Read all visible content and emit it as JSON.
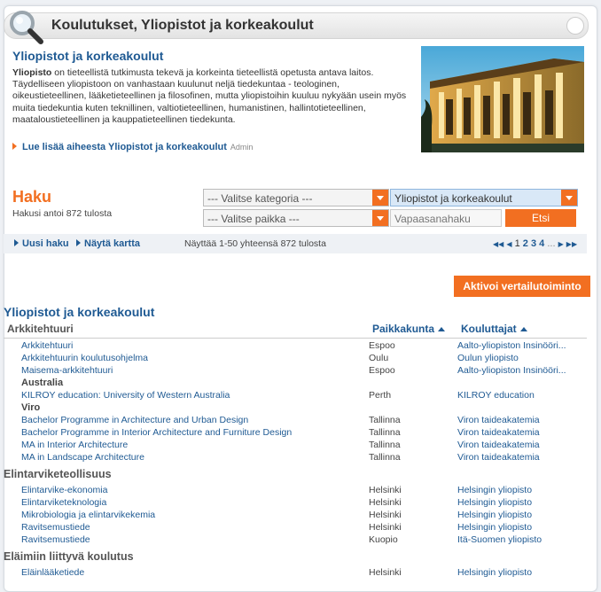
{
  "header": {
    "title": "Koulutukset, Yliopistot ja korkeakoulut"
  },
  "intro": {
    "title": "Yliopistot ja korkeakoulut",
    "lead": "Yliopisto",
    "text": " on tieteellistä tutkimusta tekevä ja korkeinta tieteellistä opetusta antava laitos. Täydelliseen yliopistoon on vanhastaan kuulunut neljä tiedekuntaa - teologinen, oikeustieteellinen, lääketieteellinen ja filosofinen, mutta yliopistoihin kuuluu nykyään usein myös muita tiedekuntia kuten teknillinen, valtiotieteellinen, humanistinen, hallintotieteellinen, maataloustieteellinen ja kauppatieteellinen tiedekunta.",
    "read_more": "Lue lisää aiheesta Yliopistot ja korkeakoulut",
    "admin": "Admin"
  },
  "search": {
    "title": "Haku",
    "result_count": "Hakusi antoi 872 tulosta",
    "category_placeholder": "--- Valitse kategoria ---",
    "category_selected": "Yliopistot ja korkeakoulut",
    "place_placeholder": "--- Valitse paikka ---",
    "freetext_placeholder": "Vapaasanahaku",
    "submit": "Etsi"
  },
  "navbar": {
    "new_search": "Uusi haku",
    "show_map": "Näytä kartta",
    "showing": "Näyttää 1-50 yhteensä 872 tulosta",
    "pager": {
      "first": "◀◀",
      "prev": "◀",
      "pages": [
        "1",
        "2",
        "3",
        "4"
      ],
      "ellipsis": "...",
      "next": "▶",
      "last": "▶▶"
    }
  },
  "compare_button": "Aktivoi vertailutoiminto",
  "results": {
    "title": "Yliopistot ja korkeakoulut",
    "first_category": "Arkkitehtuuri",
    "col_location": "Paikkakunta",
    "col_provider": "Kouluttajat",
    "rows": [
      {
        "kind": "row",
        "name": "Arkkitehtuuri",
        "place": "Espoo",
        "provider": "Aalto-yliopiston Insinööri..."
      },
      {
        "kind": "row",
        "name": "Arkkitehtuurin koulutusohjelma",
        "place": "Oulu",
        "provider": "Oulun yliopisto"
      },
      {
        "kind": "row",
        "name": "Maisema-arkkitehtuuri",
        "place": "Espoo",
        "provider": "Aalto-yliopiston Insinööri..."
      },
      {
        "kind": "country",
        "name": "Australia"
      },
      {
        "kind": "row",
        "name": "KILROY education: University of Western Australia",
        "place": "Perth",
        "provider": "KILROY education"
      },
      {
        "kind": "country",
        "name": "Viro"
      },
      {
        "kind": "row",
        "name": "Bachelor Programme in Architecture and Urban Design",
        "place": "Tallinna",
        "provider": "Viron taideakatemia"
      },
      {
        "kind": "row",
        "name": "Bachelor Programme in Interior Architecture and Furniture Design",
        "place": "Tallinna",
        "provider": "Viron taideakatemia"
      },
      {
        "kind": "row",
        "name": "MA in Interior Architecture",
        "place": "Tallinna",
        "provider": "Viron taideakatemia"
      },
      {
        "kind": "row",
        "name": "MA in Landscape Architecture",
        "place": "Tallinna",
        "provider": "Viron taideakatemia"
      },
      {
        "kind": "cat",
        "name": "Elintarviketeollisuus"
      },
      {
        "kind": "row",
        "name": "Elintarvike-ekonomia",
        "place": "Helsinki",
        "provider": "Helsingin yliopisto"
      },
      {
        "kind": "row",
        "name": "Elintarviketeknologia",
        "place": "Helsinki",
        "provider": "Helsingin yliopisto"
      },
      {
        "kind": "row",
        "name": "Mikrobiologia ja elintarvikekemia",
        "place": "Helsinki",
        "provider": "Helsingin yliopisto"
      },
      {
        "kind": "row",
        "name": "Ravitsemustiede",
        "place": "Helsinki",
        "provider": "Helsingin yliopisto"
      },
      {
        "kind": "row",
        "name": "Ravitsemustiede",
        "place": "Kuopio",
        "provider": "Itä-Suomen yliopisto"
      },
      {
        "kind": "cat",
        "name": "Eläimiin liittyvä koulutus"
      },
      {
        "kind": "row",
        "name": "Eläinlääketiede",
        "place": "Helsinki",
        "provider": "Helsingin yliopisto"
      }
    ]
  },
  "colors": {
    "accent": "#f26f21",
    "link": "#1f5a93"
  }
}
